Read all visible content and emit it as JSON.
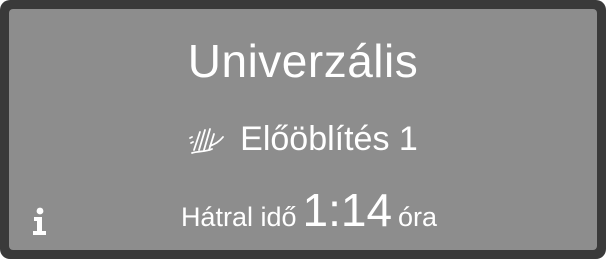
{
  "display": {
    "program_name": "Univerzális",
    "phase": {
      "icon": "prewash-icon",
      "label": "Előöblítés 1"
    },
    "time": {
      "label": "Hátral idő",
      "value": "1:14",
      "unit": "óra"
    },
    "info_icon": "info-icon"
  },
  "colors": {
    "screen_background": "#8d8d8d",
    "bezel": "#3a3a3a",
    "text": "#ffffff"
  }
}
